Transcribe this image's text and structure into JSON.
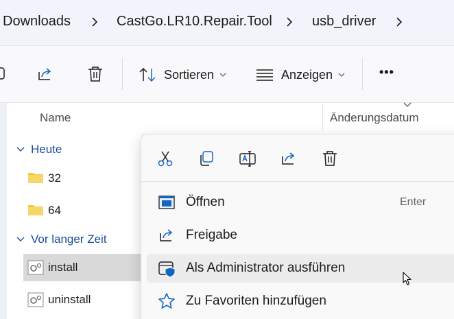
{
  "breadcrumb": {
    "items": [
      "Downloads",
      "CastGo.LR10.Repair.Tool",
      "usb_driver"
    ]
  },
  "toolbar": {
    "sort_label": "Sortieren",
    "view_label": "Anzeigen",
    "more_label": "•••"
  },
  "file_list": {
    "columns": {
      "name": "Name",
      "date": "Änderungsdatum"
    },
    "groups": [
      {
        "label": "Heute",
        "items": [
          "32",
          "64"
        ]
      },
      {
        "label": "Vor langer Zeit",
        "items": [
          "install",
          "uninstall"
        ]
      }
    ],
    "selected_item": "install"
  },
  "context_menu": {
    "top_actions": [
      "cut-icon",
      "copy-icon",
      "rename-icon",
      "share-icon",
      "delete-icon"
    ],
    "items": [
      {
        "label": "Öffnen",
        "shortcut": "Enter",
        "icon": "open-icon"
      },
      {
        "label": "Freigabe",
        "shortcut": "",
        "icon": "share-icon"
      },
      {
        "label": "Als Administrator ausführen",
        "shortcut": "",
        "icon": "admin-shield-icon"
      },
      {
        "label": "Zu Favoriten hinzufügen",
        "shortcut": "",
        "icon": "star-icon"
      }
    ],
    "hovered_item": "Als Administrator ausführen"
  },
  "colors": {
    "accent": "#1a4f99",
    "folder": "#f2c94c",
    "selection": "#d9d9d9",
    "breadcrumb_bg": "#f1f5fb"
  }
}
